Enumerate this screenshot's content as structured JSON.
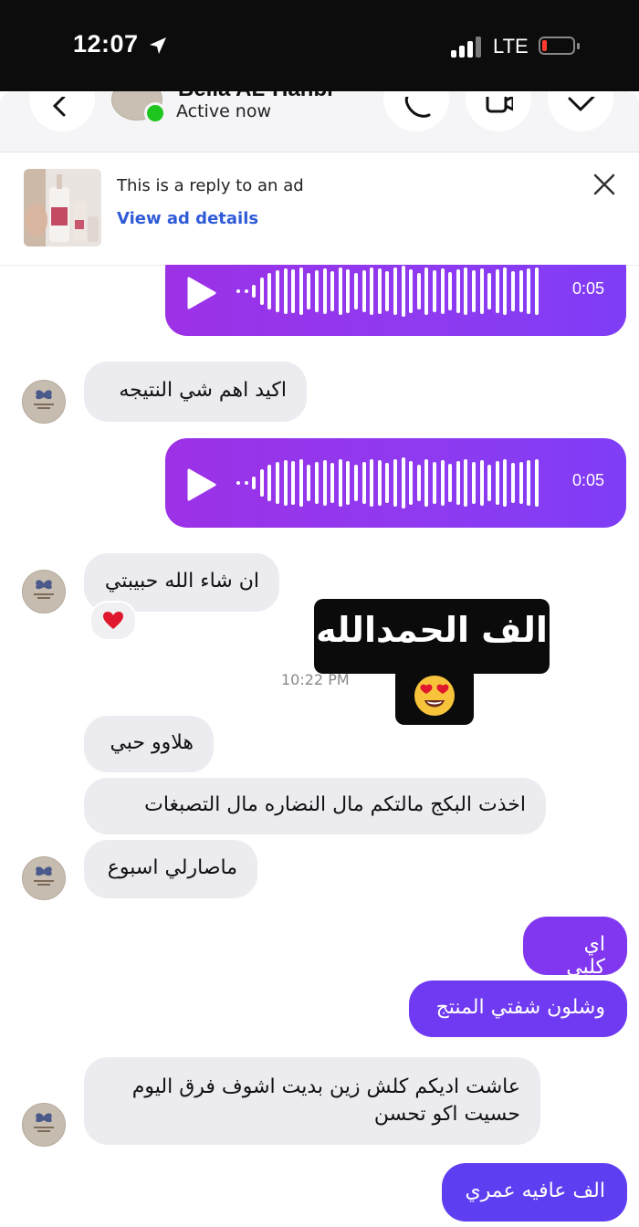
{
  "status_bar": {
    "time": "12:07",
    "network": "LTE"
  },
  "header": {
    "contact_name": "Bella AL-Hanbi",
    "status": "Active now"
  },
  "ad_banner": {
    "line1": "This is a reply to an ad",
    "link": "View ad details"
  },
  "messages": {
    "voice1_duration": "0:05",
    "in1": "اكيد اهم شي النتيجه",
    "voice2_duration": "0:05",
    "in2": "ان شاء الله حبيبتي",
    "reaction": "heart",
    "timestamp": "10:22 PM",
    "sticker_text": "الف الحمدالله",
    "in3": "هلاوو حبي",
    "in4": "اخذت البكج مالتكم مال النضاره مال التصبغات",
    "in5": "ماصارلي اسبوع",
    "out1": "اي كلبي",
    "out2": "وشلون شفتي المنتج",
    "in6_line1": "عاشت اديكم كلش زين بديت اشوف فرق اليوم",
    "in6_line2": "حسيت اكو تحسن",
    "out3": "الف عافيه عمري"
  },
  "colors": {
    "outgoing_top": "#9c31e6",
    "outgoing_bottom": "#5e3ef0",
    "incoming": "#ececf0",
    "link": "#2f5bd7",
    "online": "#1ec51e"
  }
}
